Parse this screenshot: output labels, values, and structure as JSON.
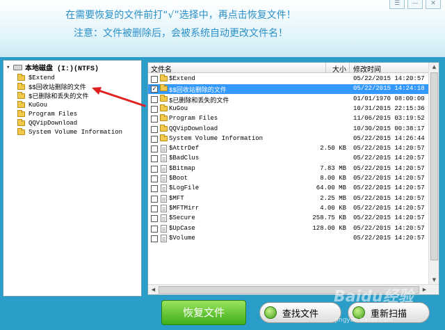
{
  "header": {
    "instruction_line1": "在需要恢复的文件前打“√”选择中，再点击恢复文件！",
    "instruction_line2": "注意：文件被删除后，会被系统自动更改文件名！",
    "window_buttons": [
      "☰",
      "—",
      "✕"
    ]
  },
  "tree": {
    "root": "本地磁盘 (I:)(NTFS)",
    "items": [
      "$Extend",
      "$$回收站删除的文件",
      "$已删除和丢失的文件",
      "KuGou",
      "Program Files",
      "QQVipDownload",
      "System Volume Information"
    ]
  },
  "list": {
    "columns": {
      "name": "文件名",
      "size": "大小",
      "date": "修改时间"
    },
    "rows": [
      {
        "type": "folder",
        "checked": false,
        "selected": false,
        "name": "$Extend",
        "size": "",
        "date": "05/22/2015 14:20:57"
      },
      {
        "type": "folder",
        "checked": true,
        "selected": true,
        "name": "$$回收站删除的文件",
        "size": "",
        "date": "05/22/2015 14:24:18"
      },
      {
        "type": "folder",
        "checked": false,
        "selected": false,
        "name": "$已删除和丢失的文件",
        "size": "",
        "date": "01/01/1970 08:00:00"
      },
      {
        "type": "folder",
        "checked": false,
        "selected": false,
        "name": "KuGou",
        "size": "",
        "date": "10/31/2015 22:15:36"
      },
      {
        "type": "folder",
        "checked": false,
        "selected": false,
        "name": "Program Files",
        "size": "",
        "date": "11/06/2015 03:19:52"
      },
      {
        "type": "folder",
        "checked": false,
        "selected": false,
        "name": "QQVipDownload",
        "size": "",
        "date": "10/30/2015 00:38:17"
      },
      {
        "type": "folder",
        "checked": false,
        "selected": false,
        "name": "System Volume Information",
        "size": "",
        "date": "05/22/2015 14:26:44"
      },
      {
        "type": "file",
        "checked": false,
        "selected": false,
        "name": "$AttrDef",
        "size": "2.50 KB",
        "date": "05/22/2015 14:20:57"
      },
      {
        "type": "file",
        "checked": false,
        "selected": false,
        "name": "$BadClus",
        "size": "",
        "date": "05/22/2015 14:20:57"
      },
      {
        "type": "file",
        "checked": false,
        "selected": false,
        "name": "$Bitmap",
        "size": "7.83 MB",
        "date": "05/22/2015 14:20:57"
      },
      {
        "type": "file",
        "checked": false,
        "selected": false,
        "name": "$Boot",
        "size": "8.00 KB",
        "date": "05/22/2015 14:20:57"
      },
      {
        "type": "file",
        "checked": false,
        "selected": false,
        "name": "$LogFile",
        "size": "64.00 MB",
        "date": "05/22/2015 14:20:57"
      },
      {
        "type": "file",
        "checked": false,
        "selected": false,
        "name": "$MFT",
        "size": "2.25 MB",
        "date": "05/22/2015 14:20:57"
      },
      {
        "type": "file",
        "checked": false,
        "selected": false,
        "name": "$MFTMirr",
        "size": "4.00 KB",
        "date": "05/22/2015 14:20:57"
      },
      {
        "type": "file",
        "checked": false,
        "selected": false,
        "name": "$Secure",
        "size": "258.75 KB",
        "date": "05/22/2015 14:20:57"
      },
      {
        "type": "file",
        "checked": false,
        "selected": false,
        "name": "$UpCase",
        "size": "128.00 KB",
        "date": "05/22/2015 14:20:57"
      },
      {
        "type": "file",
        "checked": false,
        "selected": false,
        "name": "$Volume",
        "size": "",
        "date": "05/22/2015 14:20:57"
      }
    ]
  },
  "buttons": {
    "recover": "恢复文件",
    "find": "查找文件",
    "rescan": "重新扫描"
  },
  "watermark": {
    "brand": "Baidu经验",
    "url": "jingyan.baidu.com"
  },
  "colors": {
    "accent_blue": "#2a9dc9",
    "selection": "#3399ff",
    "recover_green": "#3cae1a",
    "annotation_red": "#e02020"
  }
}
